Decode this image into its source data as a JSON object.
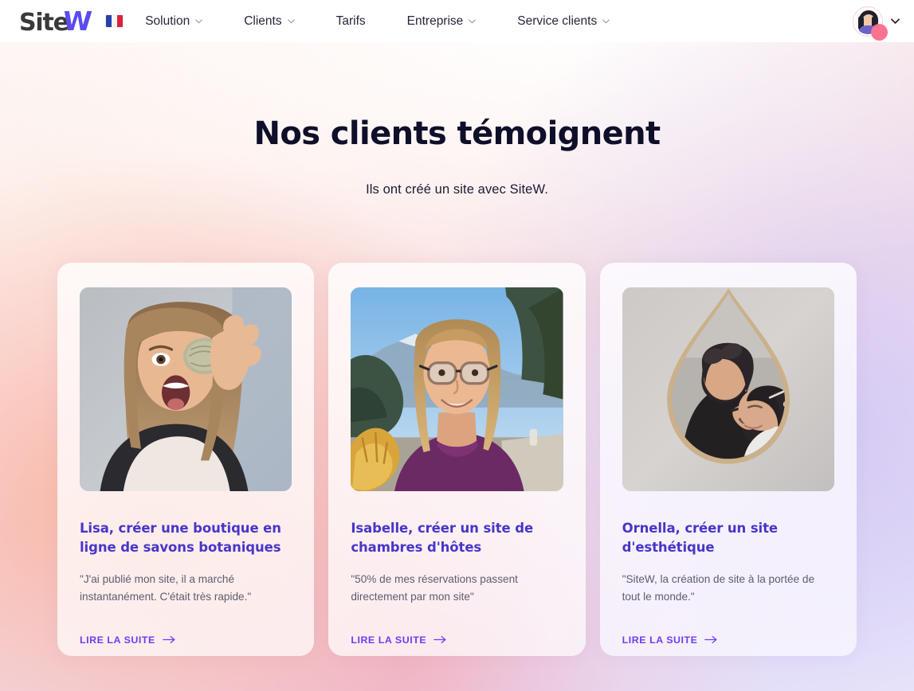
{
  "header": {
    "logo": {
      "part1": "Site",
      "part2": "W",
      "name": "SiteW"
    },
    "language_flag": "france-flag-icon",
    "nav": [
      {
        "label": "Solution",
        "has_dropdown": true
      },
      {
        "label": "Clients",
        "has_dropdown": true
      },
      {
        "label": "Tarifs",
        "has_dropdown": false
      },
      {
        "label": "Entreprise",
        "has_dropdown": true
      },
      {
        "label": "Service clients",
        "has_dropdown": true
      }
    ],
    "account": {
      "avatar_icon": "user-avatar-icon",
      "caret_icon": "chevron-down-icon"
    }
  },
  "hero": {
    "title": "Nos clients témoignent",
    "subtitle": "Ils ont créé un site avec SiteW."
  },
  "cards": [
    {
      "image_alt": "Femme tenant un savon devant son oeil",
      "title": "Lisa, créer une boutique en ligne de savons botaniques",
      "quote": "\"J'ai publié mon site, il a marché instantanément. C'était très rapide.\"",
      "link_label": "LIRE LA SUITE",
      "link_icon": "arrow-right-icon"
    },
    {
      "image_alt": "Portrait d'une femme en extérieur avec montagne",
      "title": "Isabelle, créer un site de chambres d'hôtes",
      "quote": "\"50% de mes réservations passent directement par mon site\"",
      "link_label": "LIRE LA SUITE",
      "link_icon": "arrow-right-icon"
    },
    {
      "image_alt": "Esthéticienne au travail vue dans un miroir",
      "title": "Ornella, créer un site d'esthétique",
      "quote": "\"SiteW, la création de site à la portée de tout le monde.\"",
      "link_label": "LIRE LA SUITE",
      "link_icon": "arrow-right-icon"
    }
  ],
  "colors": {
    "brand_purple": "#5b4bf0",
    "link_purple": "#6d3df5",
    "title_purple": "#4836c9",
    "heading_dark": "#100f2a",
    "quote_gray": "#5d5d70",
    "badge_pink": "#fb7390"
  }
}
